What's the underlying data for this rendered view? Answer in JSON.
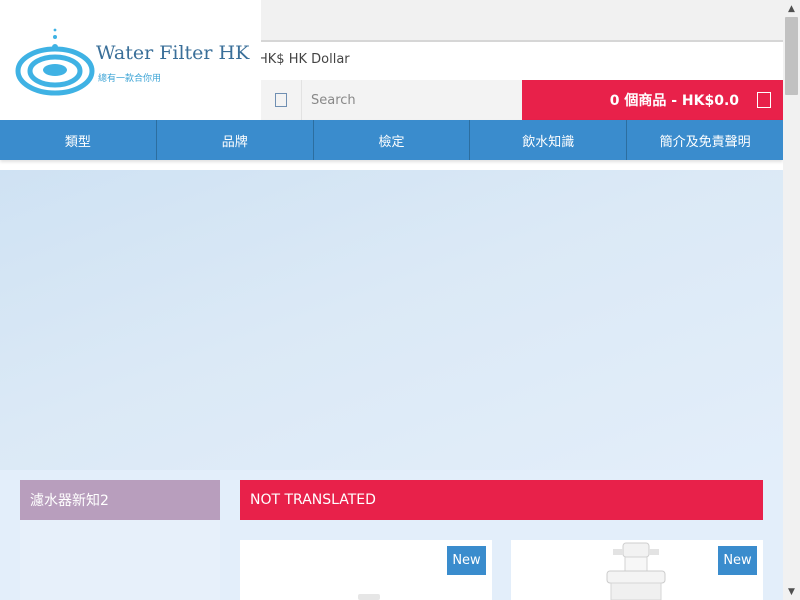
{
  "logo": {
    "title": "Water Filter HK",
    "subtitle": "總有一款合你用",
    "icon": "water-ripple-logo-icon",
    "colors": {
      "ripple": "#3fb2e4",
      "text": "#3a6f99"
    }
  },
  "currency": {
    "label": "HK$ HK Dollar"
  },
  "search": {
    "placeholder": "Search",
    "icon": "search-icon"
  },
  "cart": {
    "label": "0 個商品 - HK$0.0",
    "icon": "cart-icon",
    "color": "#e8214a"
  },
  "nav": {
    "items": [
      {
        "label": "類型"
      },
      {
        "label": "品牌"
      },
      {
        "label": "檢定"
      },
      {
        "label": "飲水知識"
      },
      {
        "label": "簡介及免責聲明"
      }
    ],
    "color": "#3a8ccd"
  },
  "sidebar": {
    "heading": "濾水器新知2",
    "color": "#b89ebd"
  },
  "main": {
    "heading": "NOT TRANSLATED",
    "products": [
      {
        "badge": "New"
      },
      {
        "badge": "New"
      }
    ]
  },
  "scrollbar": {
    "up_icon": "scroll-up-arrow-icon",
    "down_icon": "scroll-down-arrow-icon"
  }
}
